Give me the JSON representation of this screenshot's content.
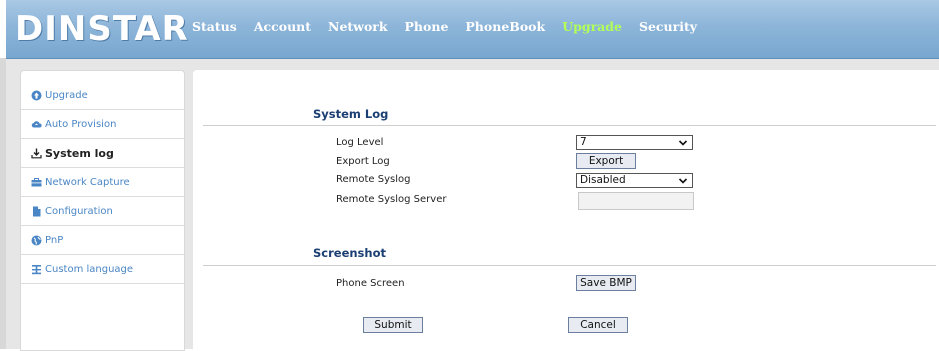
{
  "header": {
    "logo": "DINSTAR",
    "nav": [
      {
        "label": "Status",
        "active": false
      },
      {
        "label": "Account",
        "active": false
      },
      {
        "label": "Network",
        "active": false
      },
      {
        "label": "Phone",
        "active": false
      },
      {
        "label": "PhoneBook",
        "active": false
      },
      {
        "label": "Upgrade",
        "active": true
      },
      {
        "label": "Security",
        "active": false
      }
    ],
    "active_color": "#b3ff57"
  },
  "sidebar": {
    "items": [
      {
        "label": "Upgrade",
        "icon": "upgrade-icon",
        "active": false
      },
      {
        "label": "Auto Provision",
        "icon": "cloud-sync-icon",
        "active": false
      },
      {
        "label": "System log",
        "icon": "download-icon",
        "active": true
      },
      {
        "label": "Network Capture",
        "icon": "briefcase-icon",
        "active": false
      },
      {
        "label": "Configuration",
        "icon": "file-icon",
        "active": false
      },
      {
        "label": "PnP",
        "icon": "globe-icon",
        "active": false
      },
      {
        "label": "Custom language",
        "icon": "language-icon",
        "active": false
      }
    ]
  },
  "system_log": {
    "title": "System Log",
    "log_level_label": "Log Level",
    "log_level_value": "7",
    "export_log_label": "Export Log",
    "export_button": "Export",
    "remote_syslog_label": "Remote Syslog",
    "remote_syslog_value": "Disabled",
    "remote_syslog_server_label": "Remote Syslog Server",
    "remote_syslog_server_value": ""
  },
  "screenshot": {
    "title": "Screenshot",
    "phone_screen_label": "Phone Screen",
    "save_bmp_button": "Save BMP"
  },
  "actions": {
    "submit": "Submit",
    "cancel": "Cancel"
  },
  "colors": {
    "header_top": "#a9c8e4",
    "header_bottom": "#78a6cf",
    "section_title": "#1b3f73",
    "sidebar_link": "#4a86c5"
  }
}
